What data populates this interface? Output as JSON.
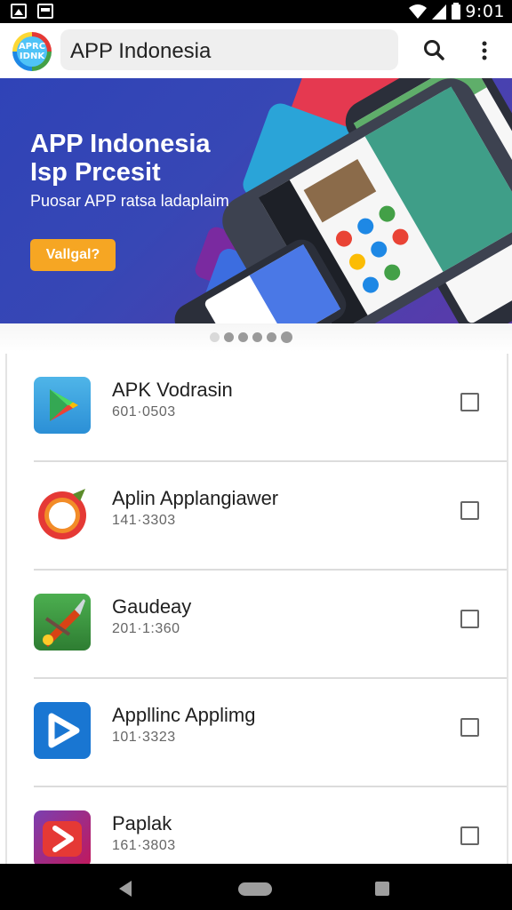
{
  "status_bar": {
    "time": "9:01",
    "left_icons": [
      "image-icon",
      "card-icon"
    ],
    "right_icons": [
      "wifi-icon",
      "signal-icon",
      "battery-icon"
    ]
  },
  "app_bar": {
    "logo_text": "APRC\nIDNK",
    "search_value": "APP Indonesia",
    "actions": [
      "search-icon",
      "more-vert-icon"
    ]
  },
  "banner": {
    "title_line1": "APP Indonesia",
    "title_line2": "Isp Prcesit",
    "subtitle": "Puosar APP ratsa ladaplaim",
    "button_label": "Vallgal?",
    "colors": {
      "background": "#3443b6",
      "button": "#f6a623"
    },
    "carousel": {
      "count": 6,
      "active_index": 5
    }
  },
  "apps": [
    {
      "name": "APK Vodrasin",
      "meta": "601·0503",
      "icon": "play-store-icon",
      "checked": false
    },
    {
      "name": "Aplin Applangiawer",
      "meta": "141·3303",
      "icon": "ring-app-icon",
      "checked": false
    },
    {
      "name": "Gaudeay",
      "meta": "201·1:360",
      "icon": "paint-brush-icon",
      "checked": false
    },
    {
      "name": "Appllinc Applimg",
      "meta": "101·3323",
      "icon": "play-button-icon",
      "checked": false
    },
    {
      "name": "Paplak",
      "meta": "161·3803",
      "icon": "arrow-app-icon",
      "checked": false
    }
  ],
  "nav_bar": [
    "back-icon",
    "home-icon",
    "recents-icon"
  ]
}
